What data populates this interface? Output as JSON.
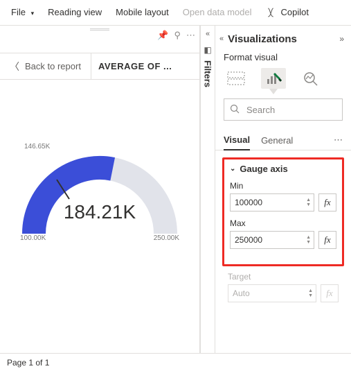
{
  "toolbar": {
    "file": "File",
    "reading_view": "Reading view",
    "mobile_layout": "Mobile layout",
    "open_data_model": "Open data model",
    "copilot": "Copilot"
  },
  "report": {
    "back_label": "Back to report",
    "header_metric": "AVERAGE OF ..."
  },
  "filters": {
    "label": "Filters"
  },
  "viz": {
    "title": "Visualizations",
    "subtitle": "Format visual",
    "search_placeholder": "Search",
    "tabs": {
      "visual": "Visual",
      "general": "General"
    },
    "gauge_axis": {
      "title": "Gauge axis",
      "min_label": "Min",
      "min_value": "100000",
      "max_label": "Max",
      "max_value": "250000",
      "target_label": "Target",
      "target_value": "Auto",
      "fx": "fx"
    }
  },
  "footer": {
    "page_status": "Page 1 of 1"
  },
  "chart_data": {
    "type": "gauge",
    "value": 184210,
    "value_display": "184.21K",
    "min": 100000,
    "min_display": "100.00K",
    "max": 250000,
    "max_display": "250.00K",
    "tick": 146650,
    "tick_display": "146.65K",
    "title": "AVERAGE OF ...",
    "colors": {
      "fill": "#3b4ed8",
      "track": "#e1e3ea"
    }
  }
}
